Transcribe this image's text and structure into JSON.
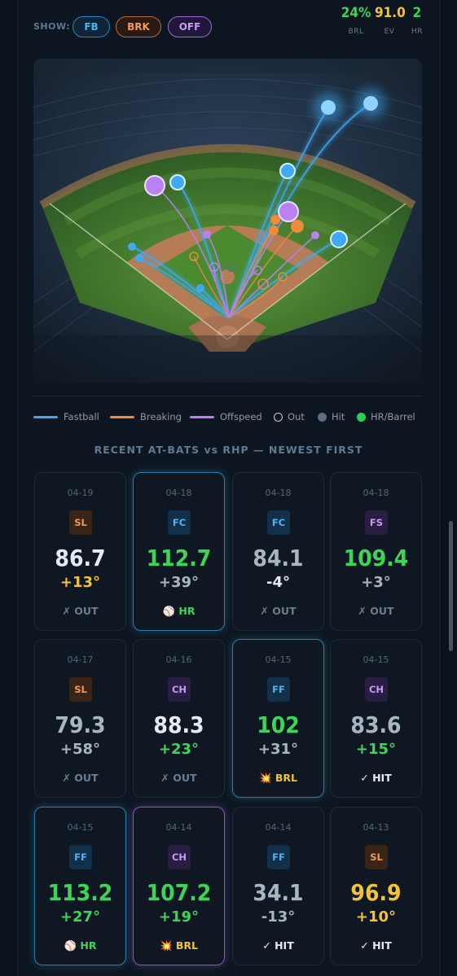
{
  "filter": {
    "label": "SHOW:",
    "buttons": [
      "FB",
      "BRK",
      "OFF"
    ]
  },
  "stats": [
    {
      "value": "24%",
      "label": "BRL",
      "color": "#3dd45a"
    },
    {
      "value": "91.0",
      "label": "EV",
      "color": "#f3c236"
    },
    {
      "value": "2",
      "label": "HR",
      "color": "#3dd45a"
    }
  ],
  "legend": {
    "fastball": "Fastball",
    "breaking": "Breaking",
    "offspeed": "Offspeed",
    "out": "Out",
    "hit": "Hit",
    "hr_barrel": "HR/Barrel"
  },
  "section_title": "RECENT AT-BATS vs RHP — NEWEST FIRST",
  "colors": {
    "fastball": "#3fa9f5",
    "breaking": "#f08a3c",
    "offspeed": "#b982f0",
    "hit_gray": "#5d6e80",
    "hr_green": "#2ccf55"
  },
  "at_bats": [
    {
      "date": "04-19",
      "pitch": "SL",
      "family": "brk",
      "ev": "86.7",
      "la": "+13°",
      "result": "✗ OUT",
      "ev_color": "white",
      "la_color": "yellow",
      "res_class": "out",
      "hl": ""
    },
    {
      "date": "04-18",
      "pitch": "FC",
      "family": "fast",
      "ev": "112.7",
      "la": "+39°",
      "result": "⚾ HR",
      "ev_color": "green",
      "la_color": "gray",
      "res_class": "hr",
      "hl": "blue"
    },
    {
      "date": "04-18",
      "pitch": "FC",
      "family": "fast",
      "ev": "84.1",
      "la": "-4°",
      "result": "✗ OUT",
      "ev_color": "gray",
      "la_color": "white",
      "res_class": "out",
      "hl": ""
    },
    {
      "date": "04-18",
      "pitch": "FS",
      "family": "off",
      "ev": "109.4",
      "la": "+3°",
      "result": "✗ OUT",
      "ev_color": "green",
      "la_color": "gray",
      "res_class": "out",
      "hl": ""
    },
    {
      "date": "04-17",
      "pitch": "SL",
      "family": "brk",
      "ev": "79.3",
      "la": "+58°",
      "result": "✗ OUT",
      "ev_color": "gray",
      "la_color": "gray",
      "res_class": "out",
      "hl": ""
    },
    {
      "date": "04-16",
      "pitch": "CH",
      "family": "off",
      "ev": "88.3",
      "la": "+23°",
      "result": "✗ OUT",
      "ev_color": "white",
      "la_color": "green",
      "res_class": "out",
      "hl": ""
    },
    {
      "date": "04-15",
      "pitch": "FF",
      "family": "fast",
      "ev": "102",
      "la": "+31°",
      "result": "💥 BRL",
      "ev_color": "green",
      "la_color": "gray",
      "res_class": "brl",
      "hl": "blue"
    },
    {
      "date": "04-15",
      "pitch": "CH",
      "family": "off",
      "ev": "83.6",
      "la": "+15°",
      "result": "✓ HIT",
      "ev_color": "gray",
      "la_color": "green",
      "res_class": "hit",
      "hl": ""
    },
    {
      "date": "04-15",
      "pitch": "FF",
      "family": "fast",
      "ev": "113.2",
      "la": "+27°",
      "result": "⚾ HR",
      "ev_color": "green",
      "la_color": "green",
      "res_class": "hr",
      "hl": "blue"
    },
    {
      "date": "04-14",
      "pitch": "CH",
      "family": "off",
      "ev": "107.2",
      "la": "+19°",
      "result": "💥 BRL",
      "ev_color": "green",
      "la_color": "green",
      "res_class": "brl",
      "hl": "purple"
    },
    {
      "date": "04-14",
      "pitch": "FF",
      "family": "fast",
      "ev": "34.1",
      "la": "-13°",
      "result": "✓ HIT",
      "ev_color": "gray",
      "la_color": "gray",
      "res_class": "hit",
      "hl": ""
    },
    {
      "date": "04-13",
      "pitch": "SL",
      "family": "brk",
      "ev": "96.9",
      "la": "+10°",
      "result": "✓ HIT",
      "ev_color": "yellow",
      "la_color": "yellow",
      "res_class": "hit",
      "hl": ""
    }
  ]
}
